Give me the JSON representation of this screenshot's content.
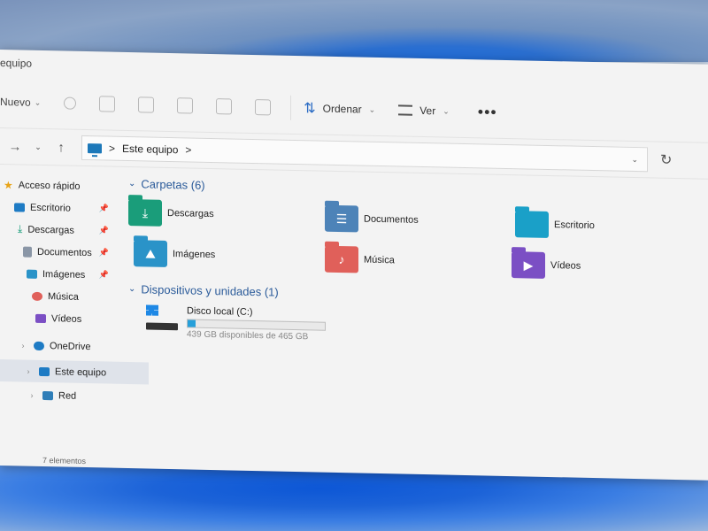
{
  "window": {
    "title": "equipo"
  },
  "toolbar": {
    "new_label": "Nuevo",
    "sort_label": "Ordenar",
    "view_label": "Ver",
    "more_label": "•••"
  },
  "address": {
    "crumb_sep": ">",
    "location": "Este equipo"
  },
  "sidebar": {
    "items": [
      {
        "label": "Acceso rápido",
        "icon": "star-icon"
      },
      {
        "label": "Escritorio",
        "icon": "desktop-icon"
      },
      {
        "label": "Descargas",
        "icon": "download-icon"
      },
      {
        "label": "Documentos",
        "icon": "documents-icon"
      },
      {
        "label": "Imágenes",
        "icon": "pictures-icon"
      },
      {
        "label": "Música",
        "icon": "music-icon"
      },
      {
        "label": "Vídeos",
        "icon": "videos-icon"
      },
      {
        "label": "OneDrive",
        "icon": "cloud-icon"
      },
      {
        "label": "Este equipo",
        "icon": "pc-icon"
      },
      {
        "label": "Red",
        "icon": "network-icon"
      }
    ]
  },
  "folders_group": {
    "header": "Carpetas (6)",
    "items": [
      {
        "label": "Descargas",
        "icon": "downloads-folder-icon",
        "color": "#1a9d7a"
      },
      {
        "label": "Documentos",
        "icon": "documents-folder-icon",
        "color": "#4d83b8"
      },
      {
        "label": "Escritorio",
        "icon": "desktop-folder-icon",
        "color": "#1aa0c8"
      },
      {
        "label": "Imágenes",
        "icon": "pictures-folder-icon",
        "color": "#2a93c8"
      },
      {
        "label": "Música",
        "icon": "music-folder-icon",
        "color": "#e0605a"
      },
      {
        "label": "Vídeos",
        "icon": "videos-folder-icon",
        "color": "#7b4fc4"
      }
    ]
  },
  "devices_group": {
    "header": "Dispositivos y unidades (1)",
    "drive": {
      "name": "Disco local (C:)",
      "free_text": "439 GB disponibles de 465 GB",
      "used_fraction": 0.056
    }
  },
  "status": {
    "count": "7 elementos"
  }
}
